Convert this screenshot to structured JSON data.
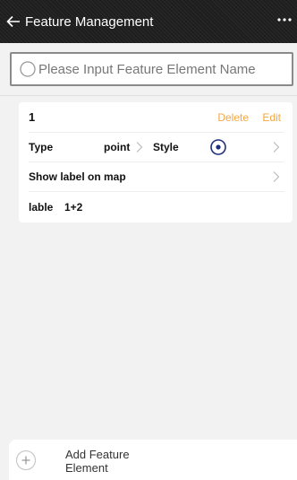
{
  "header": {
    "title": "Feature Management",
    "back_icon": "arrow-left-icon",
    "more_icon": "more-horizontal-icon"
  },
  "search": {
    "placeholder": "Please Input Feature Element Name",
    "value": "",
    "icon": "search-icon"
  },
  "feature": {
    "name": "1",
    "delete_label": "Delete",
    "edit_label": "Edit",
    "type_label": "Type",
    "type_value": "point",
    "style_label": "Style",
    "style_icon": "point-symbol-icon",
    "show_label_text": "Show label on map",
    "lable_label": "lable",
    "lable_value": "1+2"
  },
  "footer": {
    "add_label": "Add Feature Element",
    "add_icon": "plus-circle-icon"
  },
  "colors": {
    "accent": "#f5a742",
    "style_icon": "#1f2f7a",
    "header_bg": "#1e1e1e"
  }
}
